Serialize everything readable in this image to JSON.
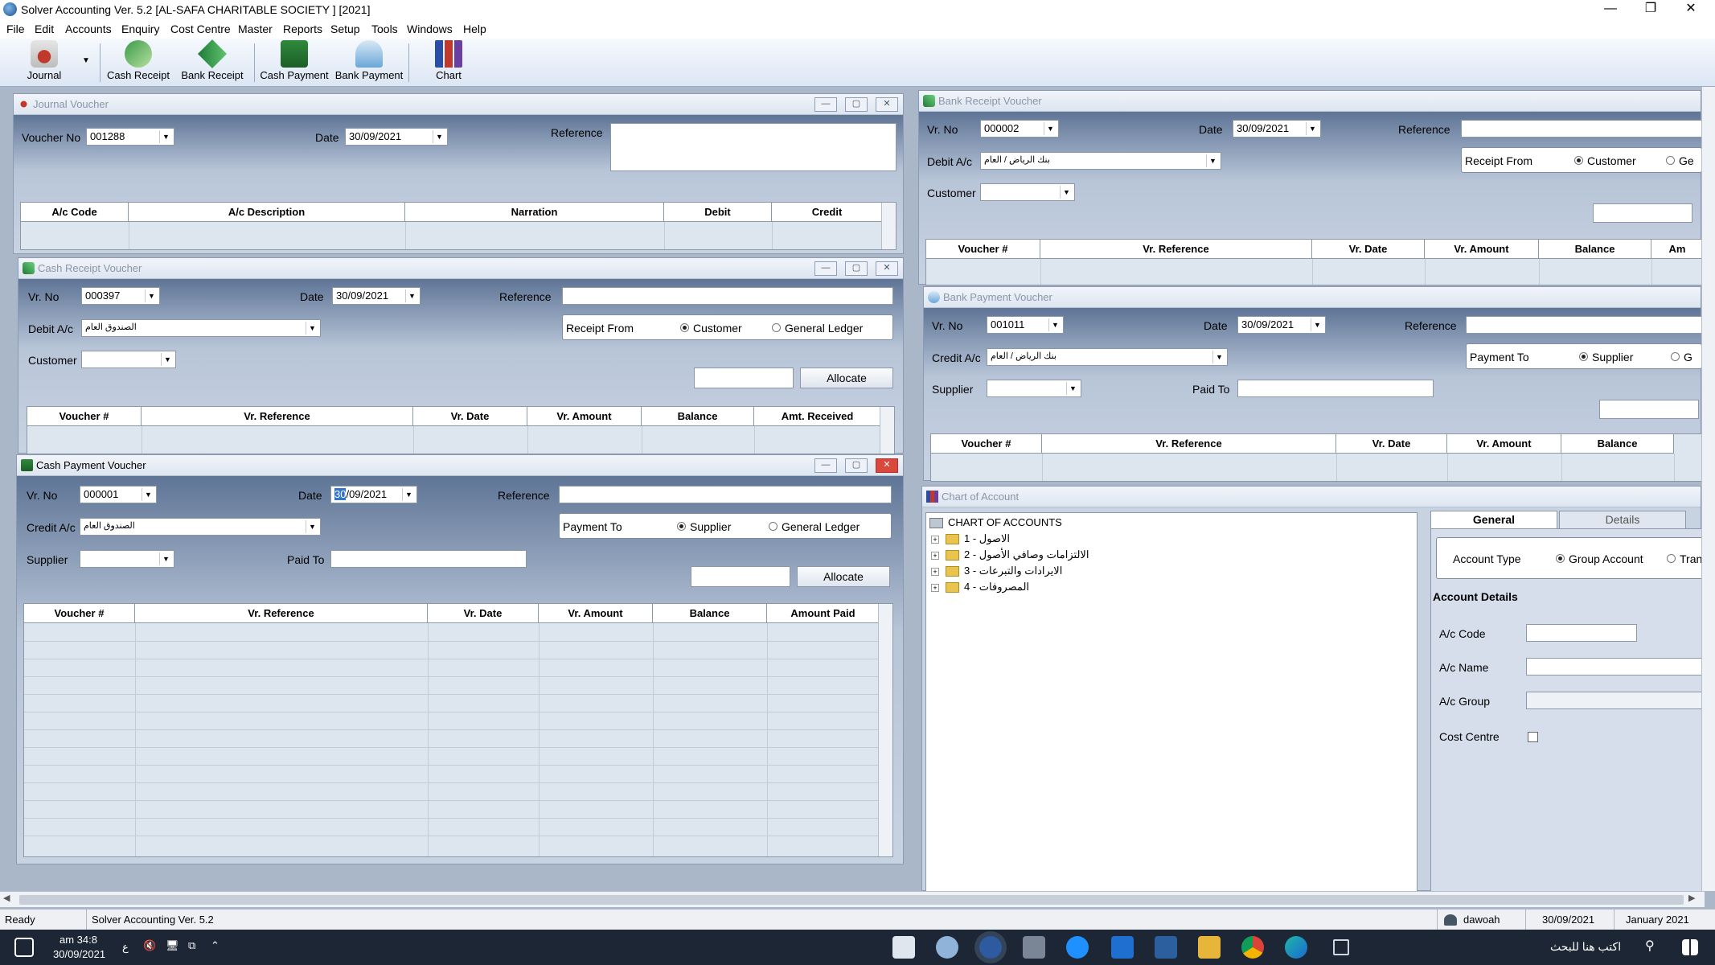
{
  "app": {
    "title": "Solver Accounting Ver. 5.2 [AL-SAFA CHARITABLE SOCIETY ] [2021]"
  },
  "menu": [
    "File",
    "Edit",
    "Accounts",
    "Enquiry",
    "Cost Centre",
    "Master",
    "Reports",
    "Setup",
    "Tools",
    "Windows",
    "Help"
  ],
  "toolbar": {
    "journal": "Journal",
    "cash_receipt": "Cash Receipt",
    "bank_receipt": "Bank Receipt",
    "cash_payment": "Cash Payment",
    "bank_payment": "Bank Payment",
    "chart": "Chart"
  },
  "journal": {
    "title": "Journal Voucher",
    "voucher_no_label": "Voucher No",
    "voucher_no": "001288",
    "date_label": "Date",
    "date": "30/09/2021",
    "reference_label": "Reference",
    "columns": [
      "A/c Code",
      "A/c Description",
      "Narration",
      "Debit",
      "Credit"
    ]
  },
  "cash_receipt": {
    "title": "Cash Receipt Voucher",
    "vr_no_label": "Vr. No",
    "vr_no": "000397",
    "date_label": "Date",
    "date": "30/09/2021",
    "reference_label": "Reference",
    "debit_label": "Debit A/c",
    "debit_value": "الصندوق العام",
    "customer_label": "Customer",
    "receipt_from_label": "Receipt From",
    "opt_customer": "Customer",
    "opt_gl": "General Ledger",
    "allocate": "Allocate",
    "columns": [
      "Voucher #",
      "Vr. Reference",
      "Vr. Date",
      "Vr. Amount",
      "Balance",
      "Amt. Received"
    ]
  },
  "cash_payment": {
    "title": "Cash Payment Voucher",
    "vr_no_label": "Vr. No",
    "vr_no": "000001",
    "date_label": "Date",
    "date": "30/09/2021",
    "date_sel": "30",
    "date_rest": "/09/2021",
    "reference_label": "Reference",
    "credit_label": "Credit A/c",
    "credit_value": "الصندوق العام",
    "supplier_label": "Supplier",
    "paid_to_label": "Paid To",
    "payment_to_label": "Payment To",
    "opt_supplier": "Supplier",
    "opt_gl": "General Ledger",
    "allocate": "Allocate",
    "columns": [
      "Voucher #",
      "Vr. Reference",
      "Vr. Date",
      "Vr. Amount",
      "Balance",
      "Amount Paid"
    ]
  },
  "bank_receipt": {
    "title": "Bank Receipt Voucher",
    "vr_no_label": "Vr. No",
    "vr_no": "000002",
    "date_label": "Date",
    "date": "30/09/2021",
    "reference_label": "Reference",
    "debit_label": "Debit A/c",
    "debit_value": "بنك الرياض / العام",
    "customer_label": "Customer",
    "receipt_from_label": "Receipt From",
    "opt_customer": "Customer",
    "opt_gl": "Ge",
    "columns": [
      "Voucher #",
      "Vr. Reference",
      "Vr. Date",
      "Vr. Amount",
      "Balance",
      "Am"
    ]
  },
  "bank_payment": {
    "title": "Bank Payment Voucher",
    "vr_no_label": "Vr. No",
    "vr_no": "001011",
    "date_label": "Date",
    "date": "30/09/2021",
    "reference_label": "Reference",
    "credit_label": "Credit A/c",
    "credit_value": "بنك الرياض / العام",
    "supplier_label": "Supplier",
    "paid_to_label": "Paid To",
    "payment_to_label": "Payment To",
    "opt_supplier": "Supplier",
    "opt_gl": "G",
    "columns": [
      "Voucher #",
      "Vr. Reference",
      "Vr. Date",
      "Vr. Amount",
      "Balance"
    ]
  },
  "chart": {
    "title": "Chart of Account",
    "root": "CHART OF ACCOUNTS",
    "nodes": [
      "1 - الاصول",
      "2 - الالتزامات وصافي الأصول",
      "3 - الايرادات والتبرعات",
      "4 - المصروفات"
    ],
    "tab_general": "General",
    "tab_details": "Details",
    "account_type_label": "Account Type",
    "opt_group": "Group Account",
    "opt_tran": "Tran",
    "details_heading": "Account Details",
    "ac_code": "A/c Code",
    "ac_name": "A/c Name",
    "ac_group": "A/c Group",
    "cost_centre": "Cost Centre"
  },
  "status": {
    "ready": "Ready",
    "version": "Solver Accounting Ver. 5.2",
    "user": "dawoah",
    "date": "30/09/2021",
    "month": "January 2021"
  },
  "taskbar": {
    "time": "am 34:8",
    "date": "30/09/2021",
    "lang": "ع",
    "search": "اكتب هنا للبحث"
  }
}
